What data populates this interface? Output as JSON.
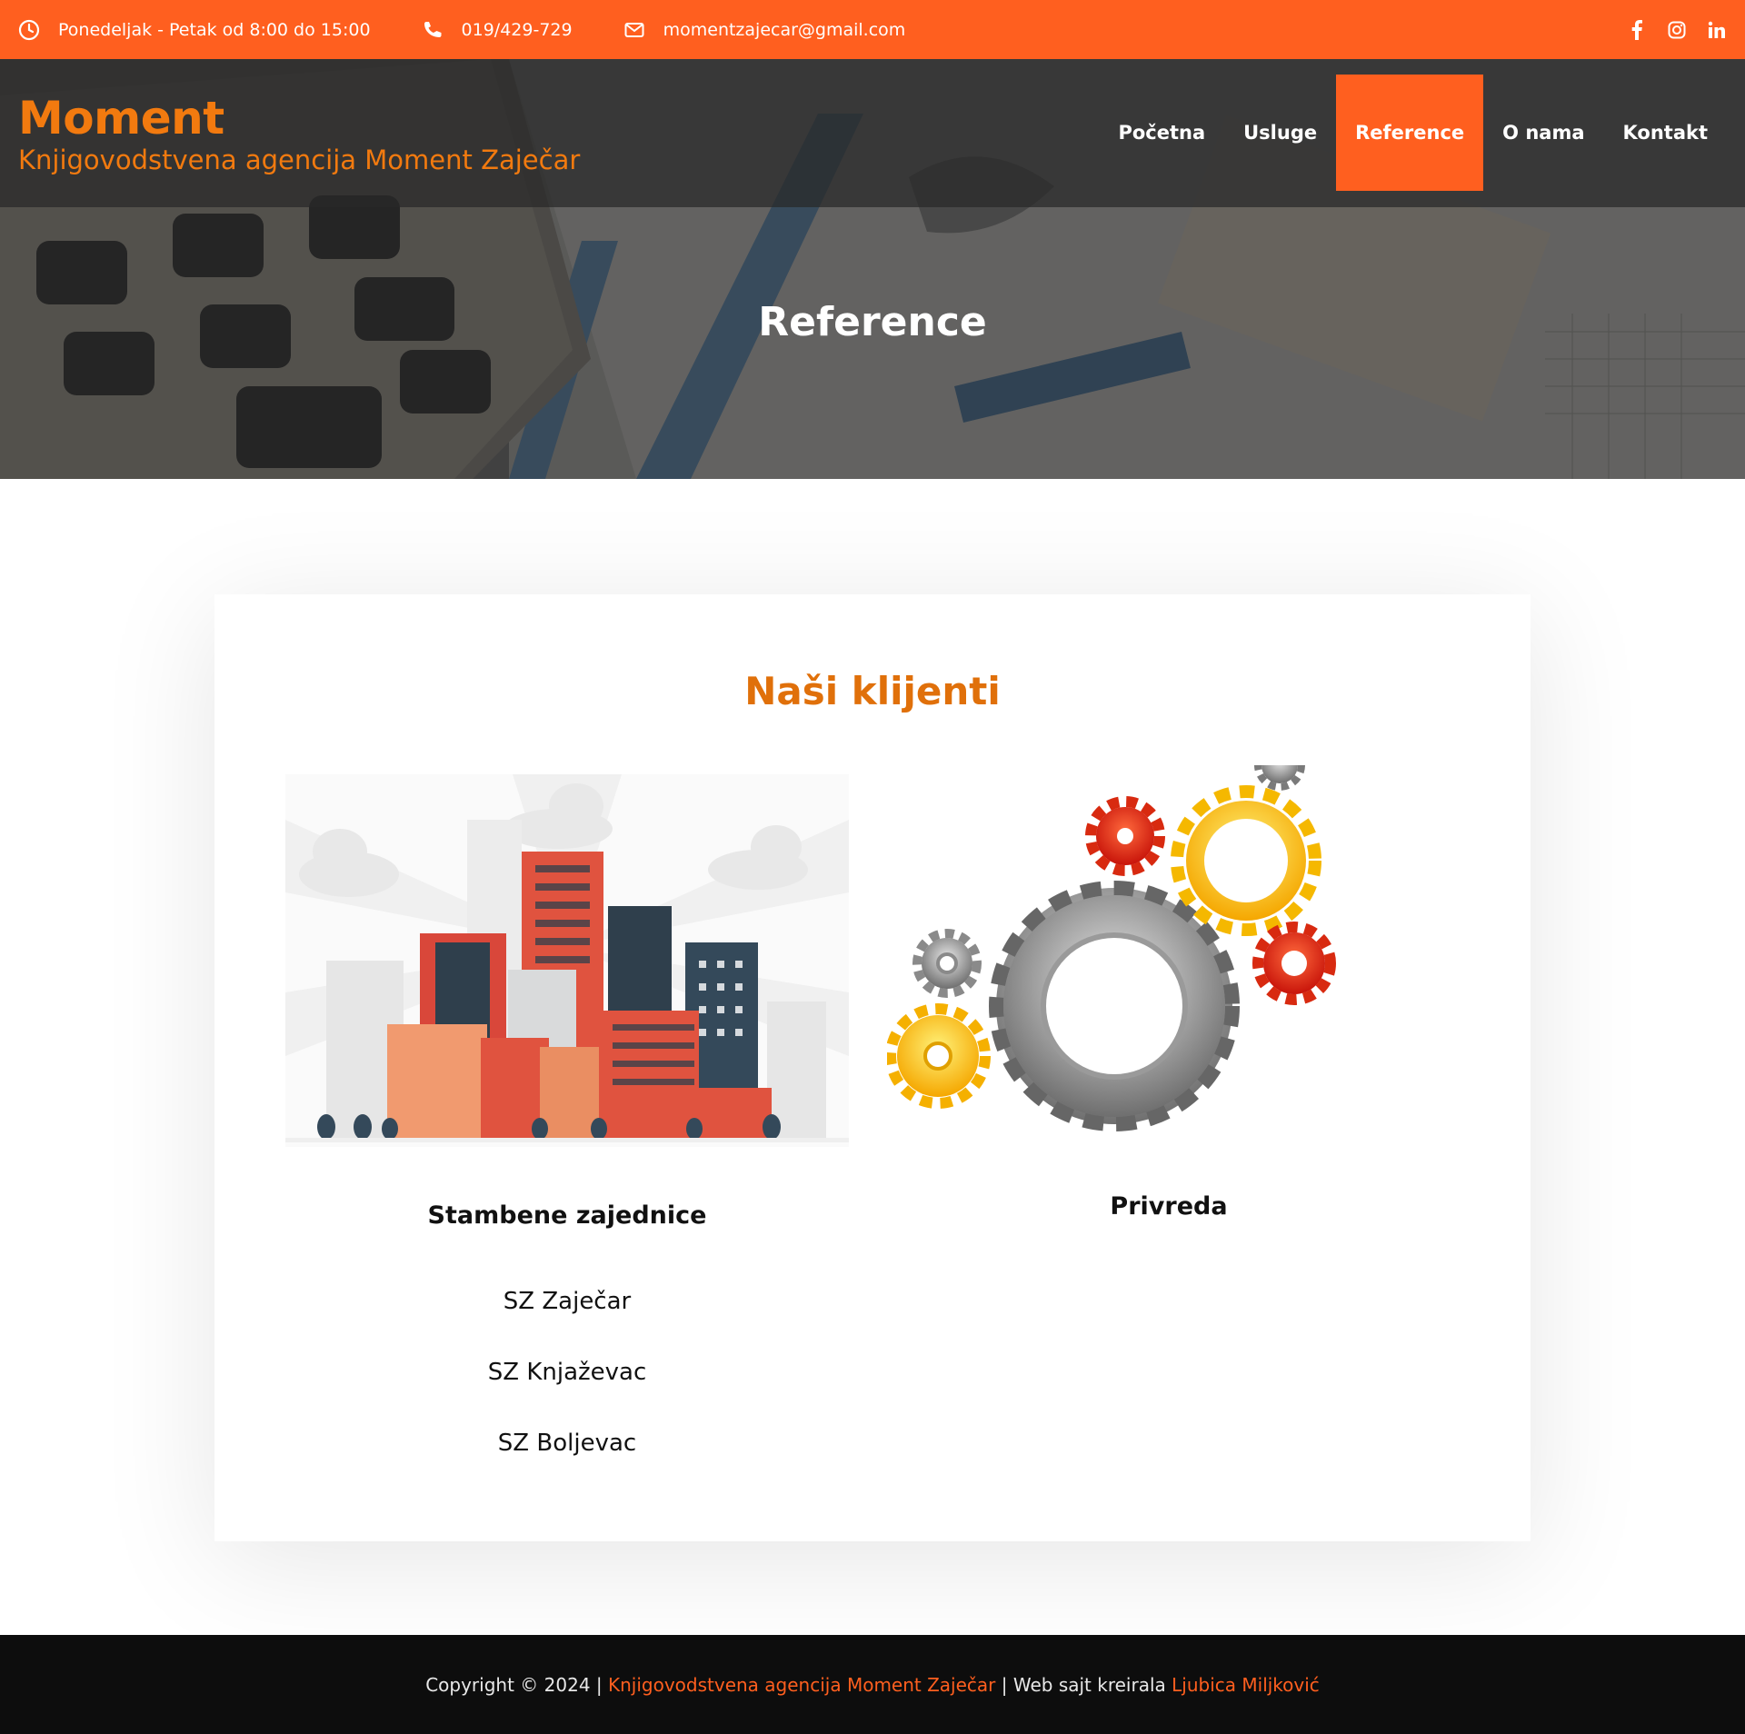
{
  "topbar": {
    "hours": "Ponedeljak - Petak od 8:00 do 15:00",
    "phone": "019/429-729",
    "email": "momentzajecar@gmail.com",
    "social_icons": [
      "facebook-icon",
      "instagram-icon",
      "linkedin-icon"
    ]
  },
  "brand": {
    "title": "Moment",
    "subtitle": "Knjigovodstvena agencija Moment Zaječar"
  },
  "nav": {
    "items": [
      {
        "label": "Početna"
      },
      {
        "label": "Usluge"
      },
      {
        "label": "Reference",
        "active": true
      },
      {
        "label": "O nama"
      },
      {
        "label": "Kontakt"
      }
    ]
  },
  "hero": {
    "title": "Reference"
  },
  "clients": {
    "title": "Naši klijenti",
    "housing": {
      "heading": "Stambene zajednice",
      "items": [
        "SZ Zaječar",
        "SZ Knjaževac",
        "SZ Boljevac"
      ]
    },
    "business": {
      "heading": "Privreda"
    }
  },
  "footer": {
    "prefix": "Copyright © 2024 | ",
    "agency": "Knjigovodstvena agencija Moment Zaječar",
    "middle": " | Web sajt kreirala ",
    "author": "Ljubica Miljković"
  },
  "colors": {
    "accent": "#ff5f1f",
    "brand_text": "#f27a0f",
    "footer_bg": "#0d0d0d"
  }
}
